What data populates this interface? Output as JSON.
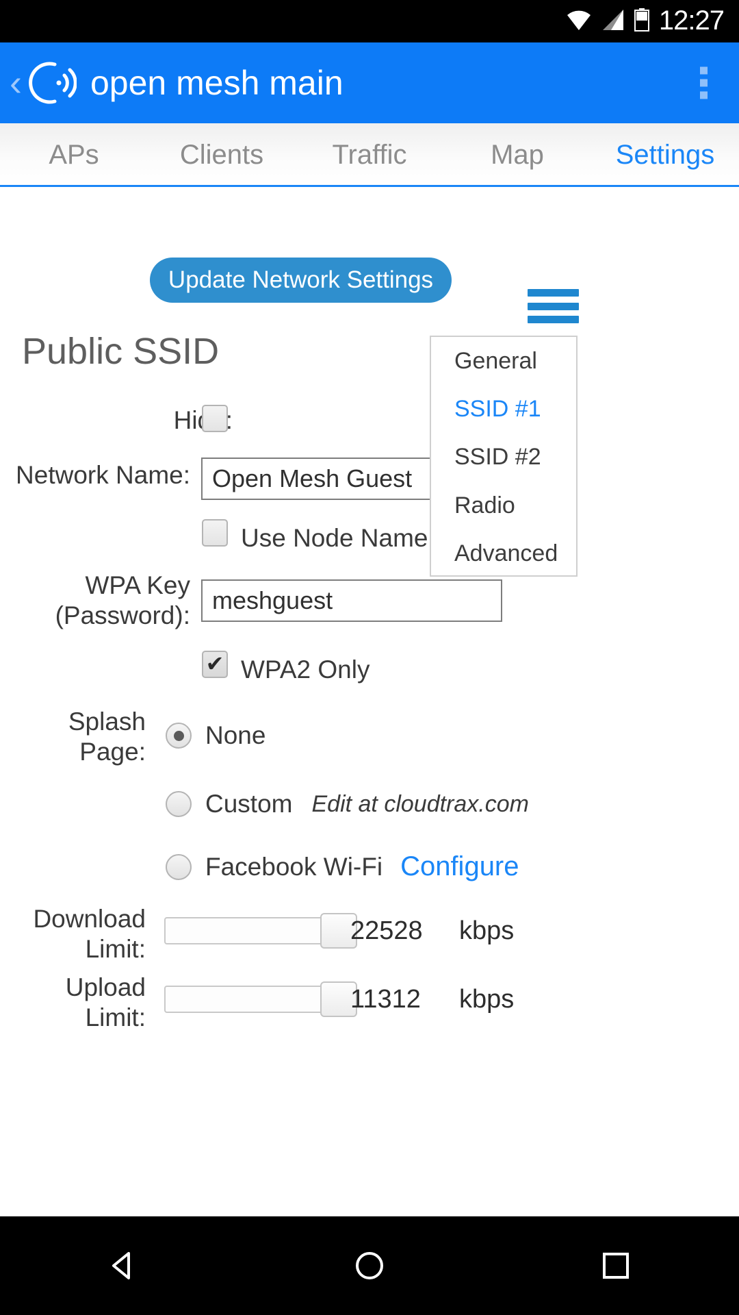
{
  "status_bar": {
    "time": "12:27",
    "icons": [
      "wifi-icon",
      "cellular-signal-icon",
      "battery-icon"
    ]
  },
  "app_bar": {
    "back_label": "‹",
    "logo_icon": "open-mesh-logo-icon",
    "title": "open mesh main",
    "overflow_icon": "overflow-menu-icon"
  },
  "tabs": {
    "items": [
      {
        "label": "APs",
        "active": false
      },
      {
        "label": "Clients",
        "active": false
      },
      {
        "label": "Traffic",
        "active": false
      },
      {
        "label": "Map",
        "active": false
      },
      {
        "label": "Settings",
        "active": true
      }
    ]
  },
  "toolbar": {
    "update_label": "Update Network Settings",
    "menu_icon": "hamburger-menu-icon"
  },
  "dropdown": {
    "items": [
      {
        "label": "General",
        "active": false
      },
      {
        "label": "SSID #1",
        "active": true
      },
      {
        "label": "SSID #2",
        "active": false
      },
      {
        "label": "Radio",
        "active": false
      },
      {
        "label": "Advanced",
        "active": false
      }
    ]
  },
  "section": {
    "title": "Public SSID"
  },
  "form": {
    "hide": {
      "label": "Hide:",
      "checked": false
    },
    "network_name": {
      "label": "Network Name:",
      "value": "Open Mesh Guest",
      "placeholder": "Network Name"
    },
    "use_node_name": {
      "label": "Use Node Name",
      "checked": false
    },
    "wpa_key": {
      "label_line1": "WPA Key",
      "label_line2": "(Password):",
      "value": "meshguest",
      "placeholder": "WPA Key"
    },
    "wpa2_only": {
      "label": "WPA2 Only",
      "checked": true,
      "tick": "✔"
    },
    "splash_page": {
      "label_line1": "Splash",
      "label_line2": "Page:",
      "options": [
        {
          "label": "None",
          "selected": true,
          "note": ""
        },
        {
          "label": "Custom",
          "selected": false,
          "note": "Edit at cloudtrax.com"
        },
        {
          "label": "Facebook Wi-Fi",
          "selected": false,
          "note": "Configure"
        }
      ]
    },
    "download_limit": {
      "label_line1": "Download",
      "label_line2": "Limit:",
      "value": "22528",
      "unit": "kbps"
    },
    "upload_limit": {
      "label_line1": "Upload",
      "label_line2": "Limit:",
      "value": "11312",
      "unit": "kbps"
    }
  },
  "nav_bar": {
    "back_icon": "nav-back-triangle-icon",
    "home_icon": "nav-home-circle-icon",
    "recents_icon": "nav-recents-square-icon"
  },
  "colors": {
    "app_bar_blue": "#0d7bf7",
    "accent_blue": "#1a86f7",
    "button_blue": "#2f8fce",
    "menu_blue": "#1f87cf"
  }
}
